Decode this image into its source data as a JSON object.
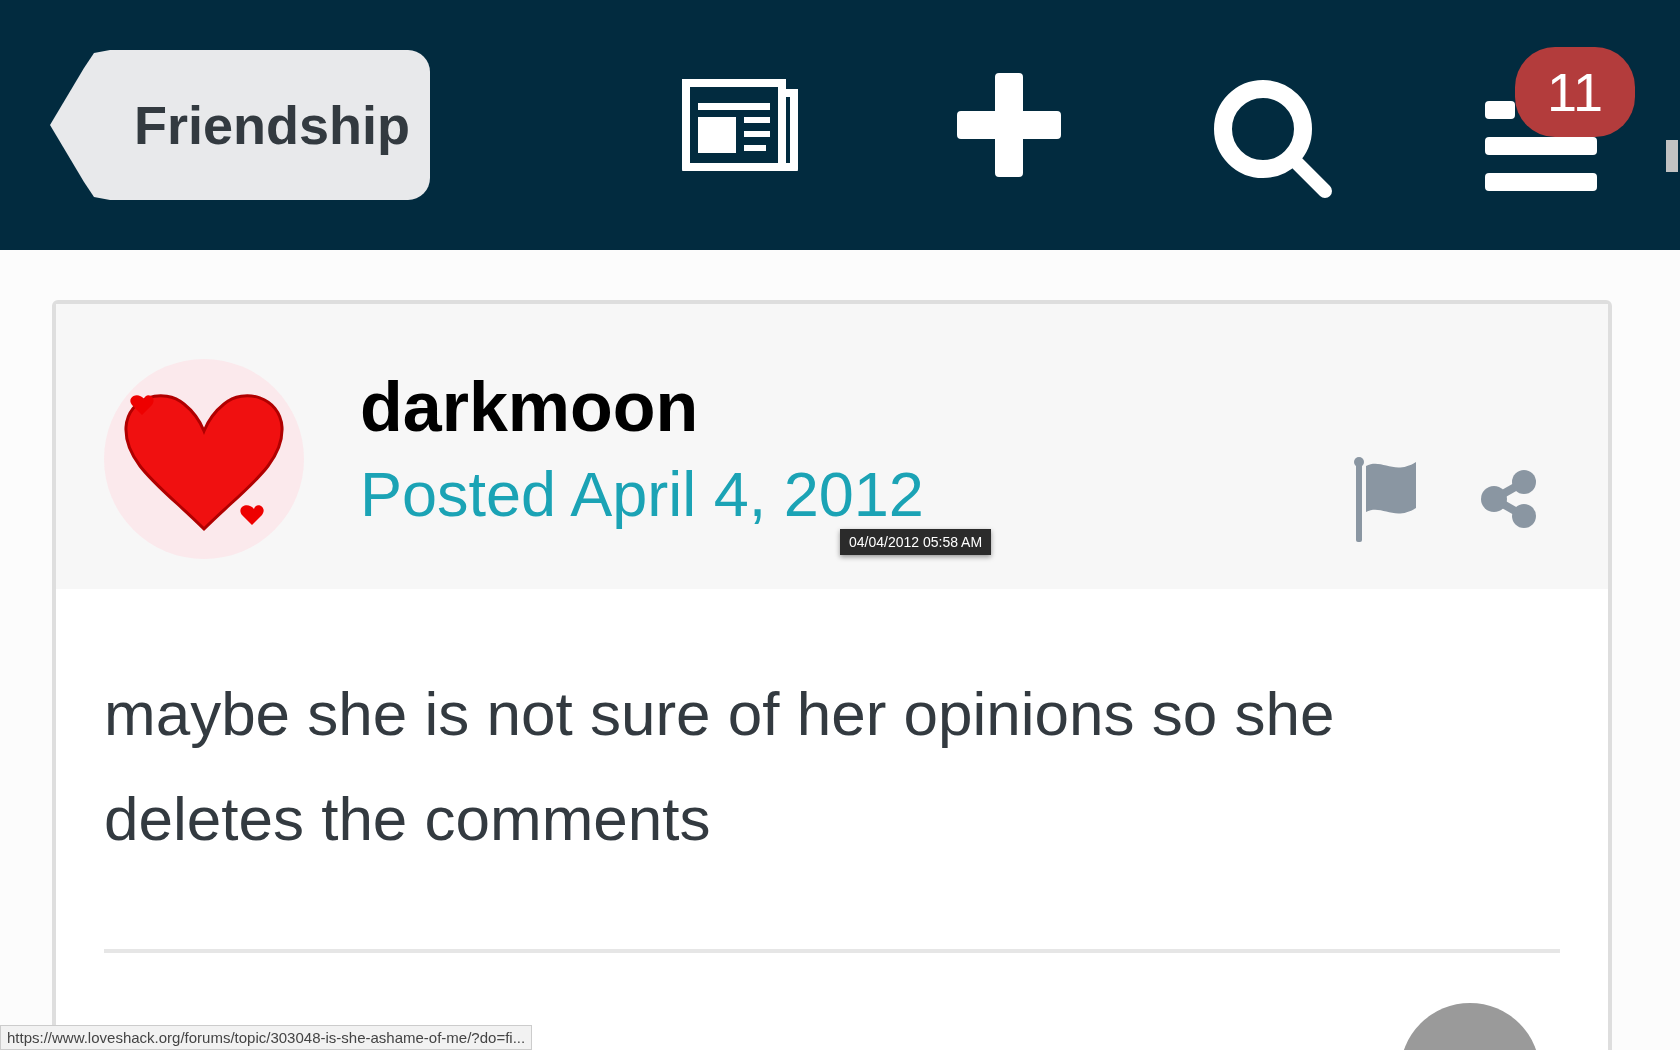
{
  "header": {
    "back_label": "Friendship",
    "notification_count": "11"
  },
  "post": {
    "author": "darkmoon",
    "posted": "Posted April 4, 2012",
    "tooltip": "04/04/2012 05:58  AM",
    "body": "maybe she is not sure of her opinions so she deletes the comments"
  },
  "status_bar": "https://www.loveshack.org/forums/topic/303048-is-she-ashame-of-me/?do=fi..."
}
